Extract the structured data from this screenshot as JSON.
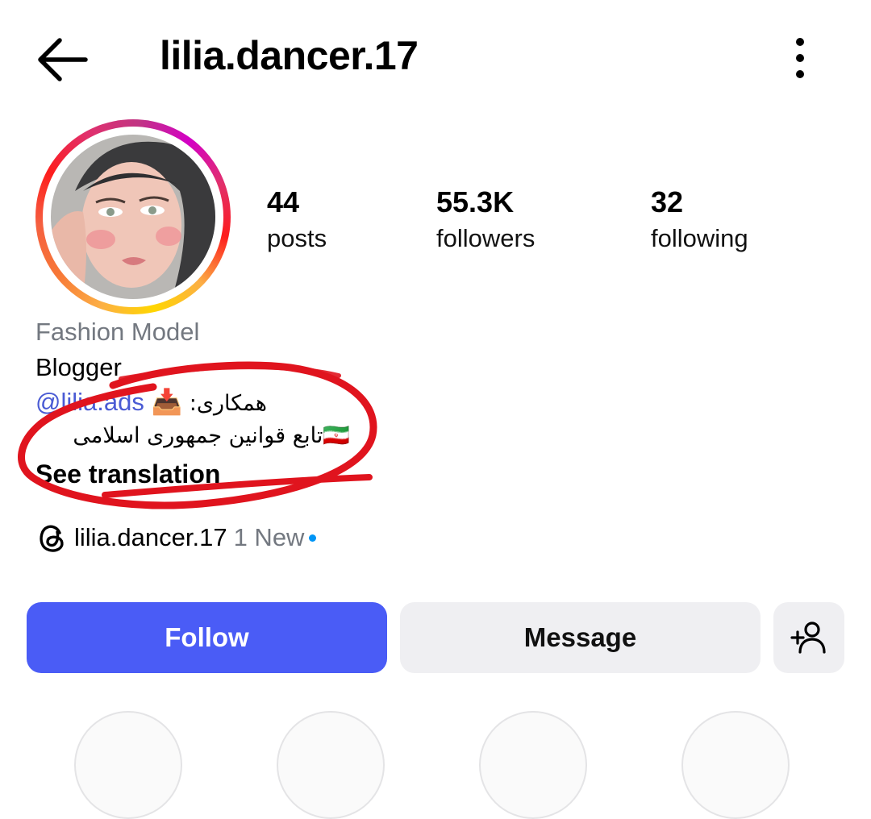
{
  "header": {
    "username": "lilia.dancer.17",
    "back_icon": "arrow-left-icon",
    "menu_icon": "more-vertical-icon"
  },
  "profile": {
    "avatar_alt": "profile photo"
  },
  "stats": [
    {
      "value": "44",
      "label": "posts"
    },
    {
      "value": "55.3K",
      "label": "followers"
    },
    {
      "value": "32",
      "label": "following"
    }
  ],
  "bio": {
    "category": "Fashion Model",
    "line1": "Blogger",
    "mention": "@lilia.ads",
    "inbox_emoji": "📥",
    "rtl_line1": "همکاری:",
    "flag_emoji": "🇮🇷",
    "rtl_line2": "تابع قوانین جمهوری اسلامی",
    "see_translation": "See translation"
  },
  "threads": {
    "icon": "threads-icon",
    "username": "lilia.dancer.17",
    "new_label": "1 New"
  },
  "actions": {
    "follow_label": "Follow",
    "message_label": "Message",
    "add_user_icon": "add-user-icon"
  },
  "colors": {
    "follow_bg": "#4a5cf6",
    "secondary_bg": "#efeff2",
    "mention": "#4a5bd4",
    "muted": "#737880",
    "annotation": "#e0141e",
    "new_dot": "#0095f6"
  }
}
